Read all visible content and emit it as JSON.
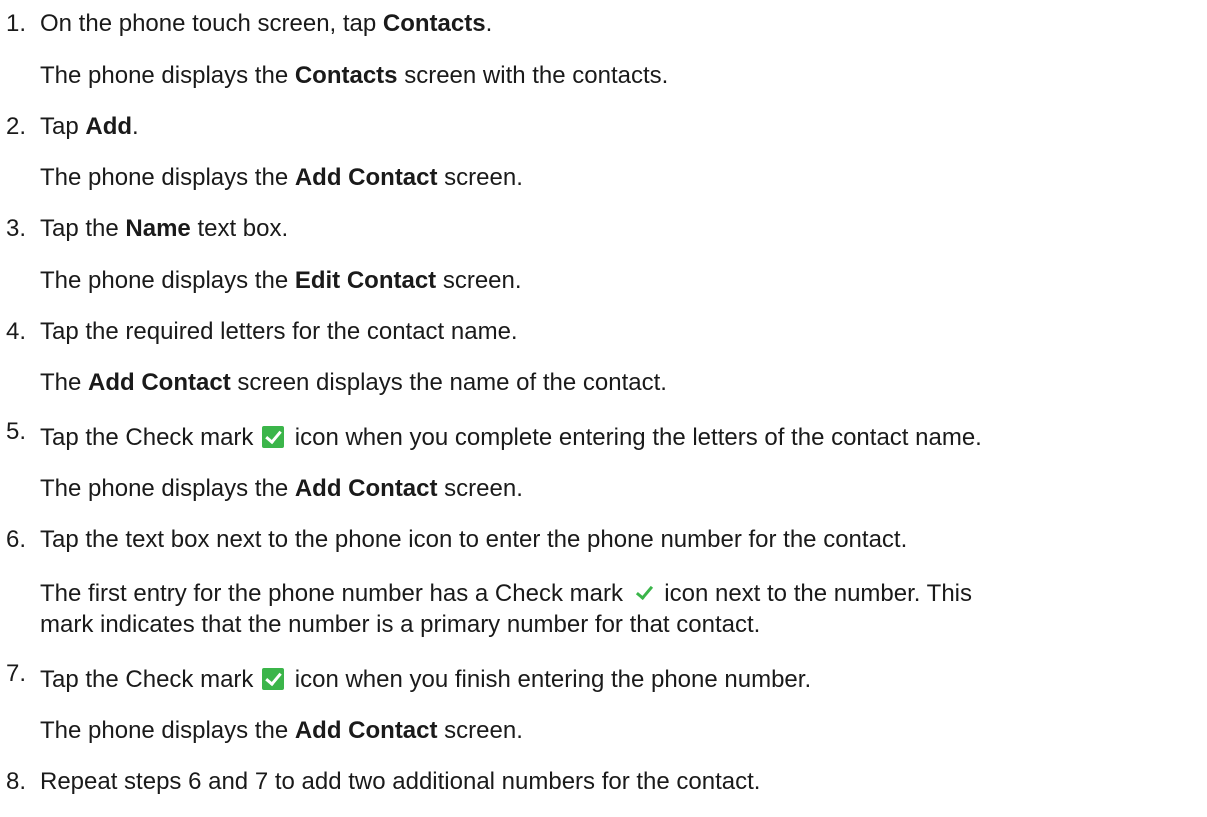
{
  "steps": [
    {
      "number": "1.",
      "action": {
        "pre": "On the phone touch screen, tap ",
        "bold": "Contacts",
        "post": "."
      },
      "result": {
        "pre": "The phone displays the ",
        "bold": "Contacts",
        "post": " screen with the contacts."
      }
    },
    {
      "number": "2.",
      "action": {
        "pre": "Tap ",
        "bold": "Add",
        "post": "."
      },
      "result": {
        "pre": "The phone displays the ",
        "bold": "Add Contact",
        "post": " screen."
      }
    },
    {
      "number": "3.",
      "action": {
        "pre": "Tap the ",
        "bold": "Name",
        "post": " text box."
      },
      "result": {
        "pre": "The phone displays the ",
        "bold": "Edit Contact",
        "post": " screen."
      }
    },
    {
      "number": "4.",
      "action": {
        "text": "Tap the required letters for the contact name."
      },
      "result": {
        "pre": "The ",
        "bold": "Add Contact",
        "post": " screen displays the name of the contact."
      }
    },
    {
      "number": "5.",
      "action": {
        "pre": "Tap the Check mark ",
        "icon": "check-mark-icon",
        "post": " icon when you complete entering the letters of the contact name."
      },
      "result": {
        "pre": "The phone displays the ",
        "bold": "Add Contact",
        "post": " screen."
      }
    },
    {
      "number": "6.",
      "action": {
        "text": "Tap the text box next to the phone icon to enter the phone number for the contact."
      },
      "result": {
        "pre": "The first entry for the phone number has a Check mark ",
        "icon": "check-mark-icon",
        "post": " icon next to the number. This",
        "line2": "mark indicates that the number is a primary number for that contact."
      }
    },
    {
      "number": "7.",
      "action": {
        "pre": "Tap the Check mark ",
        "icon": "check-mark-icon",
        "post": " icon when you finish entering the phone number."
      },
      "result": {
        "pre": "The phone displays the ",
        "bold": "Add Contact",
        "post": " screen."
      }
    },
    {
      "number": "8.",
      "action": {
        "text": "Repeat steps 6 and 7 to add two additional numbers for the contact."
      }
    }
  ],
  "colors": {
    "text": "#1a1a1a",
    "check_green": "#3bb54a",
    "background": "#ffffff"
  }
}
